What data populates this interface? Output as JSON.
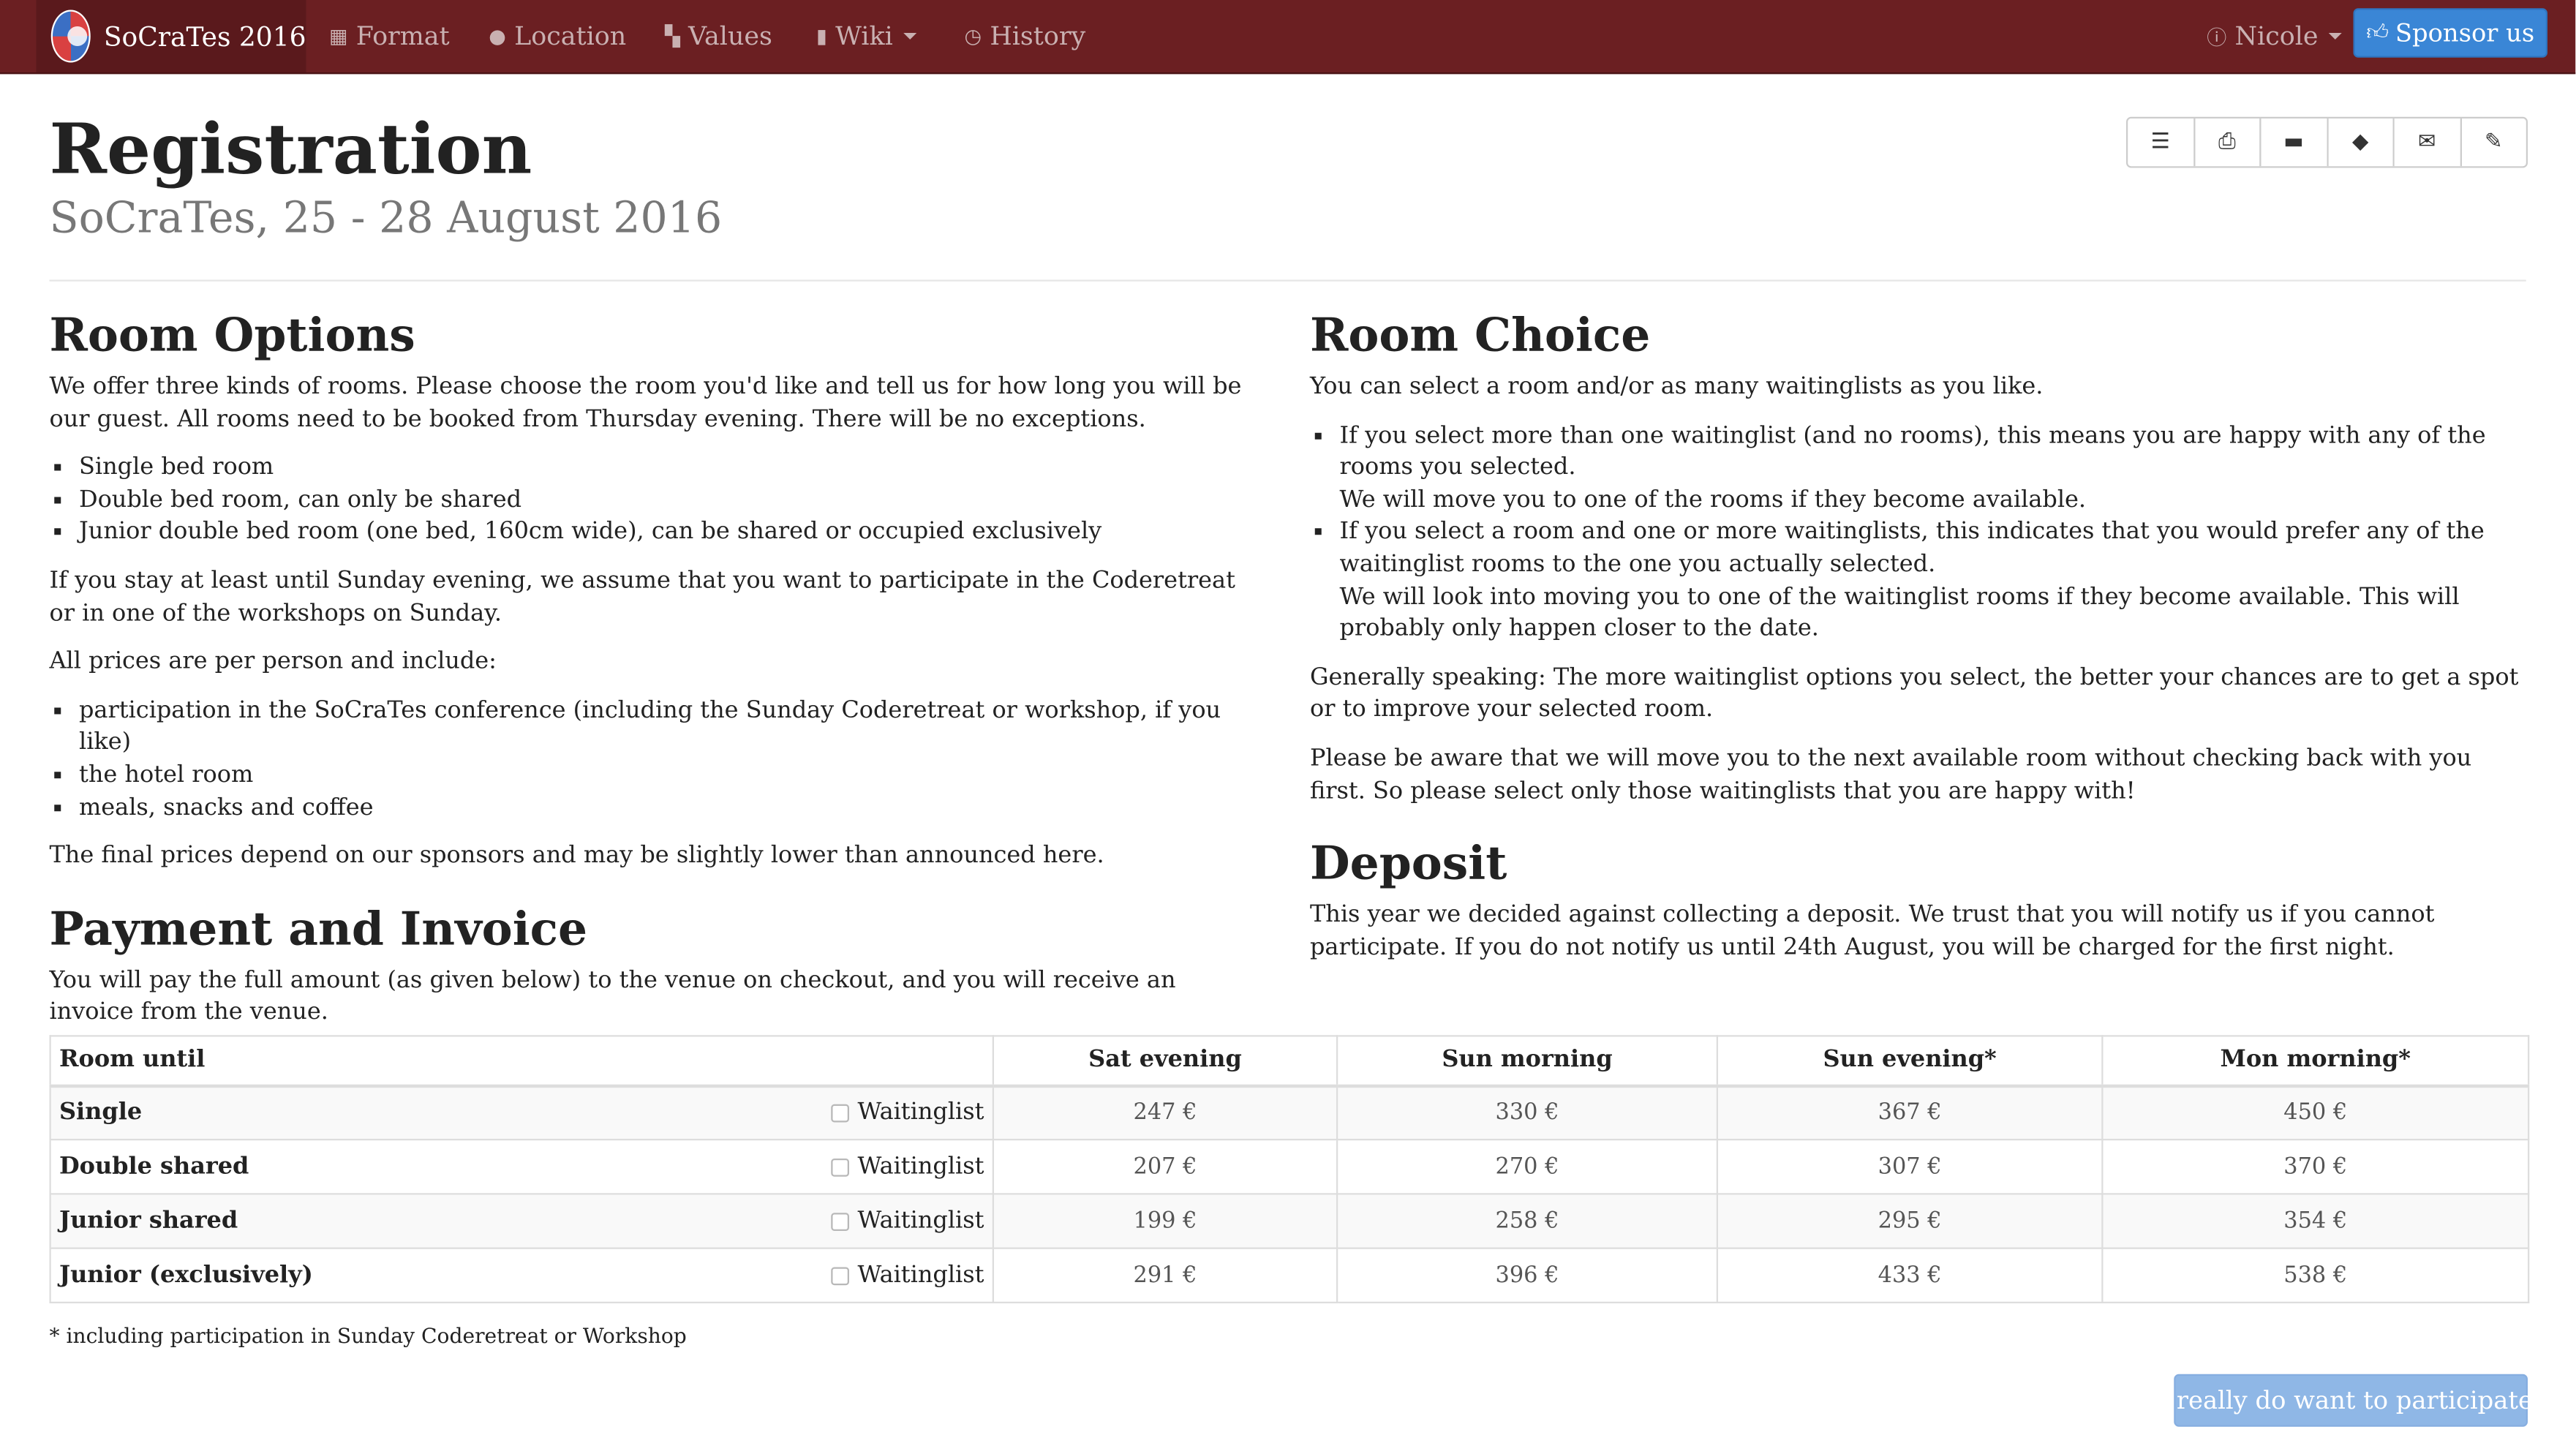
{
  "navbar": {
    "brand": "SoCraTes 2016",
    "items": [
      {
        "label": "Format",
        "icon": "calendar-icon"
      },
      {
        "label": "Location",
        "icon": "globe-icon"
      },
      {
        "label": "Values",
        "icon": "grid-icon"
      },
      {
        "label": "Wiki",
        "icon": "book-icon"
      },
      {
        "label": "History",
        "icon": "clock-icon"
      }
    ],
    "user": "Nicole",
    "sponsor_label": "Sponsor us"
  },
  "header": {
    "title": "Registration",
    "subtitle": "SoCraTes, 25 - 28 August 2016"
  },
  "toolbar": [
    "list-icon",
    "print-icon",
    "bed-icon",
    "tags-icon",
    "envelope-icon",
    "edit-icon"
  ],
  "room_options": {
    "heading": "Room Options",
    "intro": "We offer three kinds of rooms. Please choose the room you'd like and tell us for how long you will be our guest. All rooms need to be booked from Thursday evening. There will be no exceptions.",
    "rooms": [
      "Single bed room",
      "Double bed room, can only be shared",
      "Junior double bed room (one bed, 160cm wide), can be shared or occupied exclusively"
    ],
    "sunday_note": "If you stay at least until Sunday evening, we assume that you want to participate in the Coderetreat or in one of the workshops on Sunday.",
    "prices_intro": "All prices are per person and include:",
    "includes": [
      "participation in the SoCraTes conference (including the Sunday Coderetreat or workshop, if you like)",
      "the hotel room",
      "meals, snacks and coffee"
    ],
    "final_note": "The final prices depend on our sponsors and may be slightly lower than announced here."
  },
  "payment": {
    "heading": "Payment and Invoice",
    "text": "You will pay the full amount (as given below) to the venue on checkout, and you will receive an invoice from the venue."
  },
  "room_choice": {
    "heading": "Room Choice",
    "intro": "You can select a room and/or as many waitinglists as you like.",
    "points": [
      {
        "line1": "If you select more than one waitinglist (and no rooms), this means you are happy with any of the rooms you selected.",
        "line2": "We will move you to one of the rooms if they become available."
      },
      {
        "line1": "If you select a room and one or more waitinglists, this indicates that you would prefer any of the waitinglist rooms to the one you actually selected.",
        "line2": "We will look into moving you to one of the waitinglist rooms if they become available. This will probably only happen closer to the date."
      }
    ],
    "general": "Generally speaking: The more waitinglist options you select, the better your chances are to get a spot or to improve your selected room.",
    "warning": "Please be aware that we will move you to the next available room without checking back with you first. So please select only those waitinglists that you are happy with!"
  },
  "deposit": {
    "heading": "Deposit",
    "text": "This year we decided against collecting a deposit. We trust that you will notify us if you cannot participate. If you do not notify us until 24th August, you will be charged for the first night."
  },
  "table": {
    "headers": [
      "Room until",
      "Sat evening",
      "Sun morning",
      "Sun evening*",
      "Mon morning*"
    ],
    "waitinglist_label": "Waitinglist",
    "rows": [
      {
        "name": "Single",
        "prices": [
          "247 €",
          "330 €",
          "367 €",
          "450 €"
        ]
      },
      {
        "name": "Double shared",
        "prices": [
          "207 €",
          "270 €",
          "307 €",
          "370 €"
        ]
      },
      {
        "name": "Junior shared",
        "prices": [
          "199 €",
          "258 €",
          "295 €",
          "354 €"
        ]
      },
      {
        "name": "Junior (exclusively)",
        "prices": [
          "291 €",
          "396 €",
          "433 €",
          "538 €"
        ]
      }
    ]
  },
  "footnote": "* including participation in Sunday Coderetreat or Workshop",
  "participate_label": "I really do want to participate!"
}
